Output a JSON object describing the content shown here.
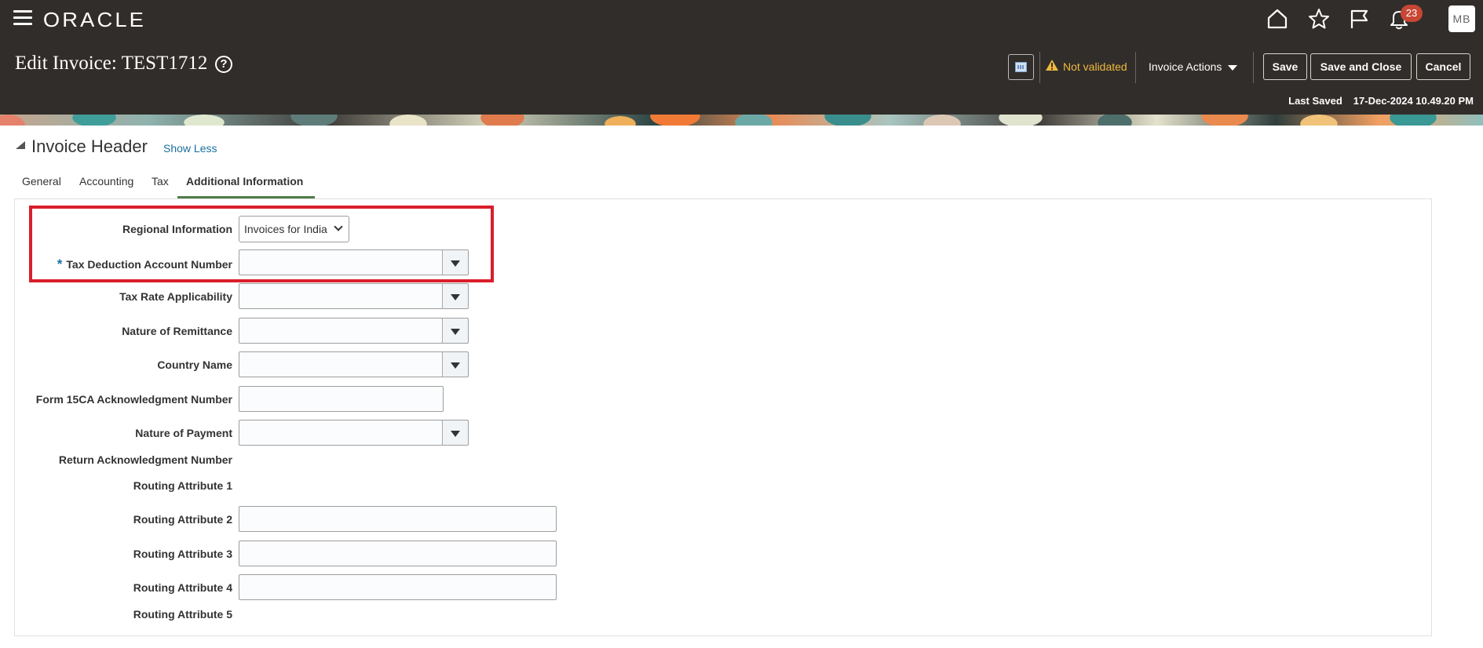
{
  "header": {
    "brand": "ORACLE",
    "page_title": "Edit Invoice: TEST1712",
    "help_glyph": "?",
    "notifications_count": "23",
    "user_initials": "MB",
    "validation_status": "Not validated",
    "actions_menu": "Invoice Actions",
    "save_label": "Save",
    "save_close_label": "Save and Close",
    "cancel_label": "Cancel",
    "last_saved_label": "Last Saved",
    "last_saved_value": "17-Dec-2024 10.49.20 PM",
    "icons": [
      "hamburger-icon",
      "home-icon",
      "star-icon",
      "flag-icon",
      "bell-icon",
      "calculator-icon",
      "warning-icon"
    ]
  },
  "section": {
    "title": "Invoice Header",
    "toggle_link": "Show Less"
  },
  "tabs": [
    {
      "label": "General",
      "active": false
    },
    {
      "label": "Accounting",
      "active": false
    },
    {
      "label": "Tax",
      "active": false
    },
    {
      "label": "Additional Information",
      "active": true
    }
  ],
  "form": {
    "regional_information": {
      "label": "Regional Information",
      "value": "Invoices for India"
    },
    "tax_deduction_account_number": {
      "label": "Tax Deduction Account Number",
      "required": true,
      "value": ""
    },
    "tax_rate_applicability": {
      "label": "Tax Rate Applicability",
      "value": ""
    },
    "nature_of_remittance": {
      "label": "Nature of Remittance",
      "value": ""
    },
    "country_name": {
      "label": "Country Name",
      "value": ""
    },
    "form_15ca_ack_number": {
      "label": "Form 15CA Acknowledgment Number",
      "value": ""
    },
    "nature_of_payment": {
      "label": "Nature of Payment",
      "value": ""
    },
    "return_ack_number": {
      "label": "Return Acknowledgment Number"
    },
    "routing_attribute_1": {
      "label": "Routing Attribute 1"
    },
    "routing_attribute_2": {
      "label": "Routing Attribute 2",
      "value": ""
    },
    "routing_attribute_3": {
      "label": "Routing Attribute 3",
      "value": ""
    },
    "routing_attribute_4": {
      "label": "Routing Attribute 4",
      "value": ""
    },
    "routing_attribute_5": {
      "label": "Routing Attribute 5"
    }
  },
  "colors": {
    "header_bg": "#312d2a",
    "warning": "#f0b93e",
    "link": "#1a6fa1",
    "badge": "#c74634",
    "highlight_box": "#d91e2a",
    "active_tab_underline": "#4f7d4a"
  }
}
